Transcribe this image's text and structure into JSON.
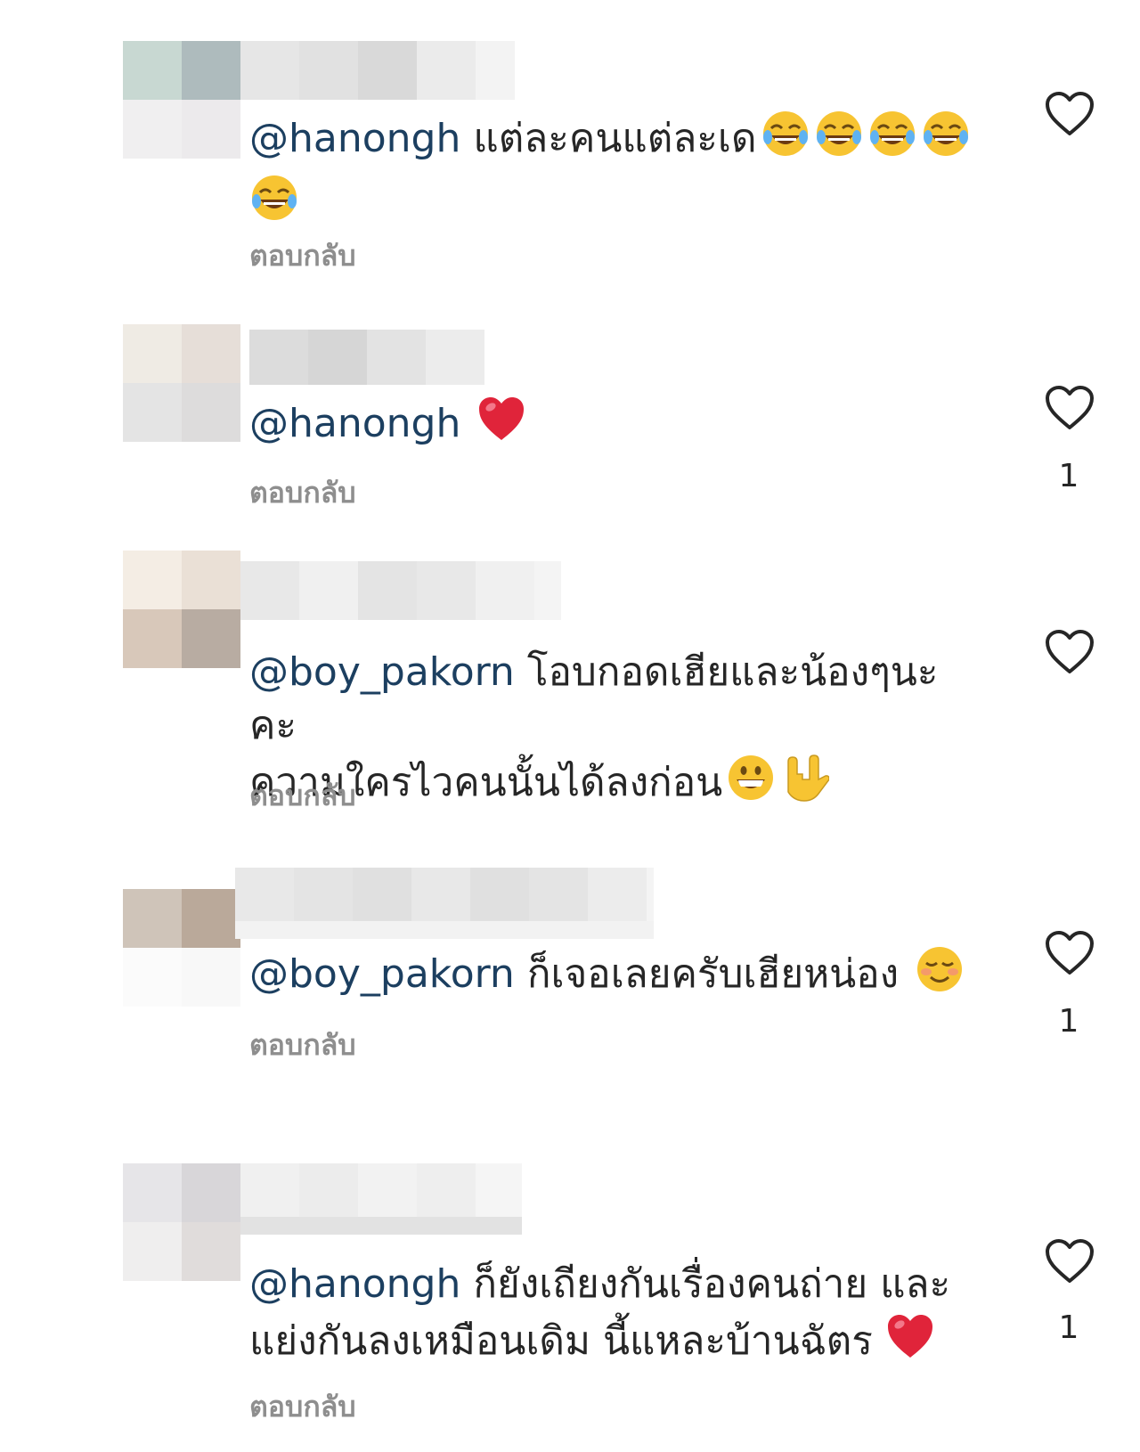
{
  "comments": [
    {
      "mention": "@hanongh",
      "text": "แต่ละคนแต่ละเด",
      "line2": "",
      "emojis": [
        "tears-of-joy",
        "tears-of-joy",
        "tears-of-joy",
        "tears-of-joy",
        "tears-of-joy"
      ],
      "reply_label": "ตอบกลับ",
      "likes": ""
    },
    {
      "mention": "@hanongh",
      "text": "",
      "line2": "",
      "emojis": [
        "red-heart"
      ],
      "reply_label": "ตอบกลับ",
      "likes": "1"
    },
    {
      "mention": "@boy_pakorn",
      "text": "โอบกอดเฮียและน้องๆนะคะ",
      "line2": "ความใครไวคนนั้นได้ลงก่อน",
      "emojis": [
        "grinning-face",
        "love-you-gesture"
      ],
      "reply_label": "ตอบกลับ",
      "likes": ""
    },
    {
      "mention": "@boy_pakorn",
      "text": "ก็เจอเลยครับเฮียหน่อง",
      "line2": "",
      "emojis": [
        "smiling-face"
      ],
      "reply_label": "ตอบกลับ",
      "likes": "1"
    },
    {
      "mention": "@hanongh",
      "text": "ก็ยังเถียงกันเรื่องคนถ่าย และ",
      "line2": "แย่งกันลงเหมือนเดิม นี้แหละบ้านฉัตร",
      "emojis": [
        "red-heart"
      ],
      "reply_label": "ตอบกลับ",
      "likes": "1"
    }
  ],
  "colors": {
    "mention": "#1c3f60",
    "text": "#262626",
    "reply": "#8e8e8e",
    "heart_outline": "#262626",
    "heart_emoji": "#e0243a",
    "emoji_face": "#f7c432"
  }
}
